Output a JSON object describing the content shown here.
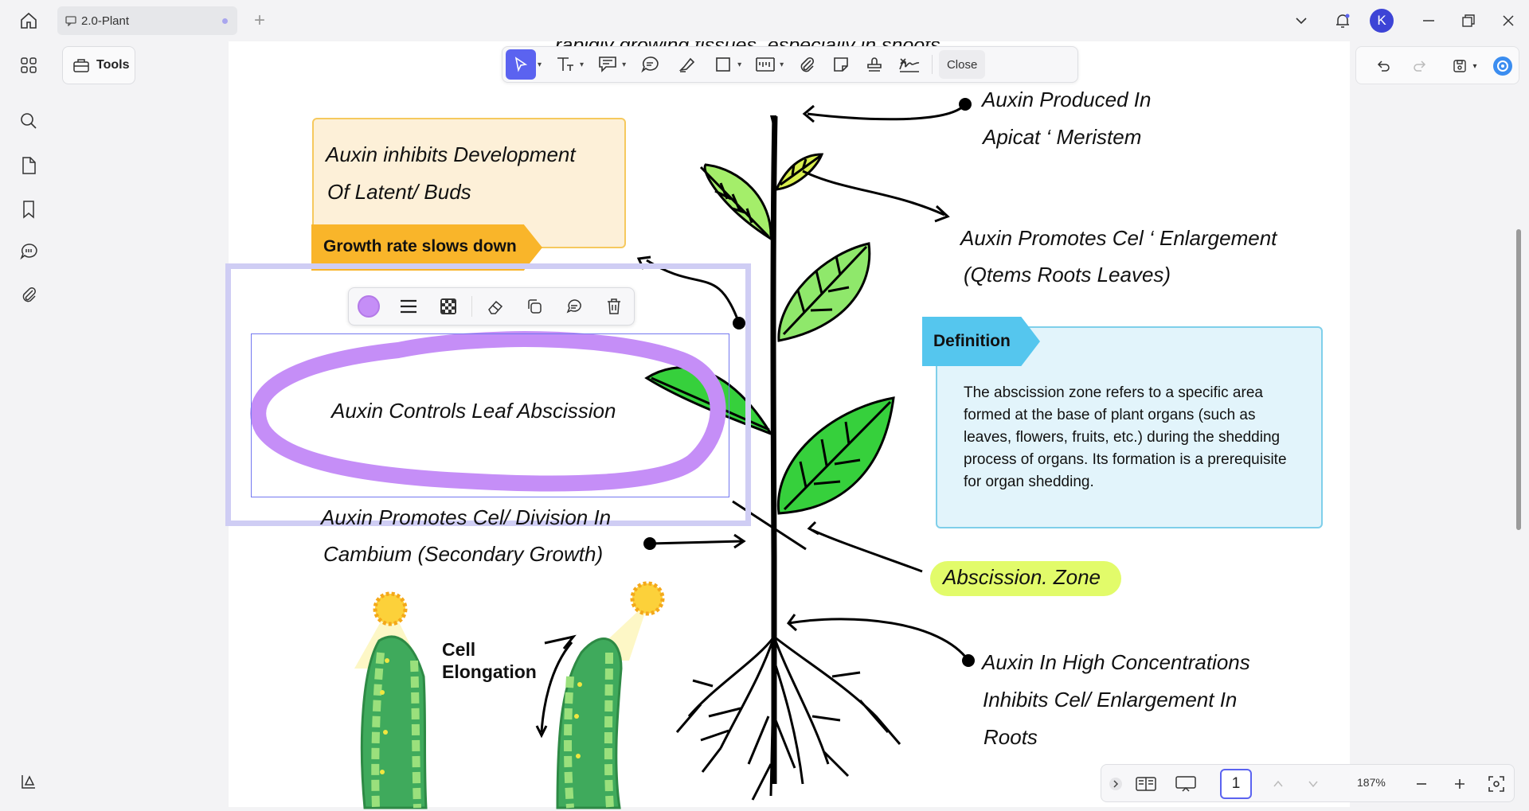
{
  "tab": {
    "title": "2.0-Plant"
  },
  "user": {
    "initial": "K"
  },
  "left_panel": {
    "tools_label": "Tools"
  },
  "toolbar": {
    "close_label": "Close"
  },
  "document": {
    "top_cut_text": "rapidly growing tissues, especially in shoots",
    "labels": {
      "produced_1": "Auxin Produced In",
      "produced_2": "Apicat ‘ Meristem",
      "inhibits_1": "Auxin inhibits Development",
      "inhibits_2": "Of Latent/ Buds",
      "growth_slows": "Growth rate slows down",
      "enlarge_1": "Auxin Promotes Cel ‘ Enlargement",
      "enlarge_2": "(Qtems Roots Leaves)",
      "abscission_ctrl": "Auxin Controls Leaf Abscission",
      "definition_title": "Definition",
      "definition_text": "The abscission zone refers to a specific area formed at the base of plant organs (such as leaves, flowers, fruits, etc.) during the shedding process of organs. Its formation is a prerequisite for organ shedding.",
      "division_1": "Auxin Promotes Cel/ Division In",
      "division_2": "Cambium (Secondary Growth)",
      "zone": "Abscission. Zone",
      "cell_elong_1": "Cell",
      "cell_elong_2": "Elongation",
      "high_conc_1": "Auxin In High Concentrations",
      "high_conc_2": "Inhibits Cel/ Enlargement In",
      "high_conc_3": "Roots"
    }
  },
  "selection": {
    "stroke_color": "#c58ef7"
  },
  "statusbar": {
    "page": "1",
    "zoom": "187%"
  },
  "colors": {
    "accent": "#5b63f0",
    "note_bg": "#fdf0d8",
    "tag_orange": "#f9b52a",
    "def_bg": "#e2f4fb",
    "zone_green": "#e2fb6a"
  }
}
